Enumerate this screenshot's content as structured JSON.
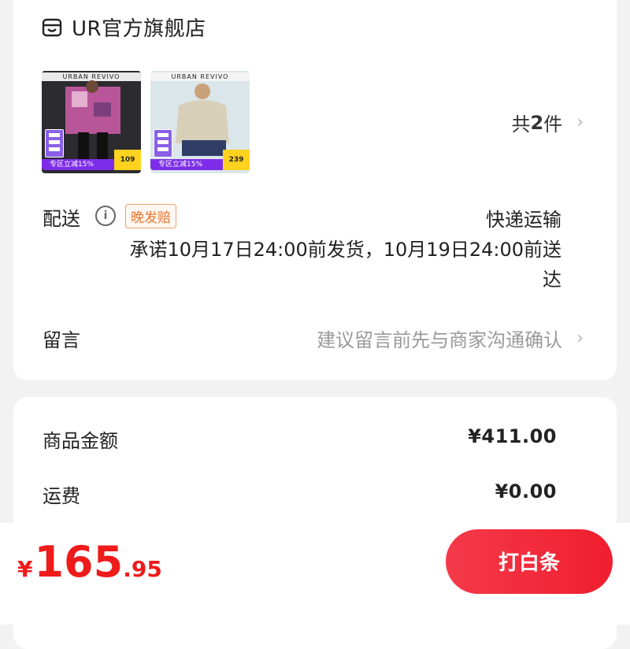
{
  "store": {
    "name": "UR官方旗舰店",
    "icon": "store-icon"
  },
  "items": [
    {
      "brand": "URBAN REVIVO",
      "promo": "专区立减15%",
      "price": "109"
    },
    {
      "brand": "URBAN REVIVO",
      "promo": "专区立减15%",
      "price": "239"
    }
  ],
  "item_count": {
    "prefix": "共",
    "num": "2",
    "suffix": "件"
  },
  "shipping": {
    "label": "配送",
    "badge": "晚发赔",
    "method": "快递运输",
    "promise": "承诺10月17日24:00前发货，10月19日24:00前送达"
  },
  "message": {
    "label": "留言",
    "hint": "建议留言前先与商家沟通确认"
  },
  "costs": {
    "goods_label": "商品金额",
    "goods_value": "¥411.00",
    "freight_label": "运费",
    "freight_value": "¥0.00"
  },
  "footer": {
    "currency": "¥",
    "total_int": "165",
    "total_dec": ".95",
    "pay_label": "打白条"
  },
  "colors": {
    "accent": "#ee1b1b",
    "badge": "#e8742c",
    "promo": "#7d2de8"
  }
}
